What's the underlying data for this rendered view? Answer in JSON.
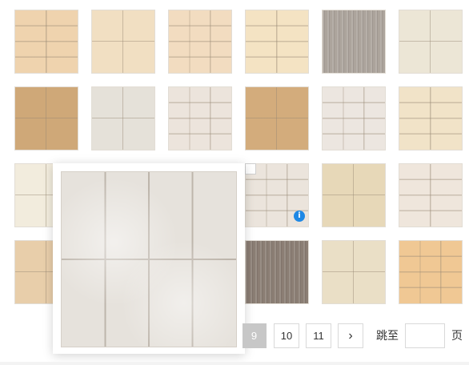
{
  "tiles": [
    {
      "color": "#efd3ae",
      "pattern": "grid43"
    },
    {
      "color": "#f1dfc2",
      "pattern": "grid4"
    },
    {
      "color": "#f2dcc0",
      "pattern": "grid33"
    },
    {
      "color": "#f4e3c3",
      "pattern": "grid43"
    },
    {
      "color": "#aca49c",
      "pattern": "wood"
    },
    {
      "color": "#ece6d6",
      "pattern": "grid4"
    },
    {
      "color": "#cfa878",
      "pattern": "grid4"
    },
    {
      "color": "#e5e1d9",
      "pattern": "grid4"
    },
    {
      "color": "#ece4dc",
      "pattern": "grid33"
    },
    {
      "color": "#d3ac7c",
      "pattern": "grid4"
    },
    {
      "color": "#ece6e0",
      "pattern": "grid33"
    },
    {
      "color": "#f1e3c8",
      "pattern": "grid43"
    },
    {
      "color": "#f2ecdd",
      "pattern": "grid4"
    },
    {
      "color": "#ebe4dc",
      "pattern": "grid33"
    },
    {
      "color": "#e7d8b8",
      "pattern": "grid4"
    },
    {
      "color": "#efe6dc",
      "pattern": "grid43"
    },
    {
      "color": "#e8ceaa",
      "pattern": "grid4"
    },
    {
      "color": "#8b7e74",
      "pattern": "wood"
    },
    {
      "color": "#eadfc6",
      "pattern": "grid4"
    },
    {
      "color": "#f0c894",
      "pattern": "grid33"
    }
  ],
  "preview": {
    "color": "#e6e2dc"
  },
  "info_icon": {
    "glyph": "i"
  },
  "pagination": {
    "current": "9",
    "pages": [
      "10",
      "11"
    ],
    "next_icon": "›",
    "jump_label": "跳至",
    "page_suffix": "页",
    "jump_value": ""
  }
}
